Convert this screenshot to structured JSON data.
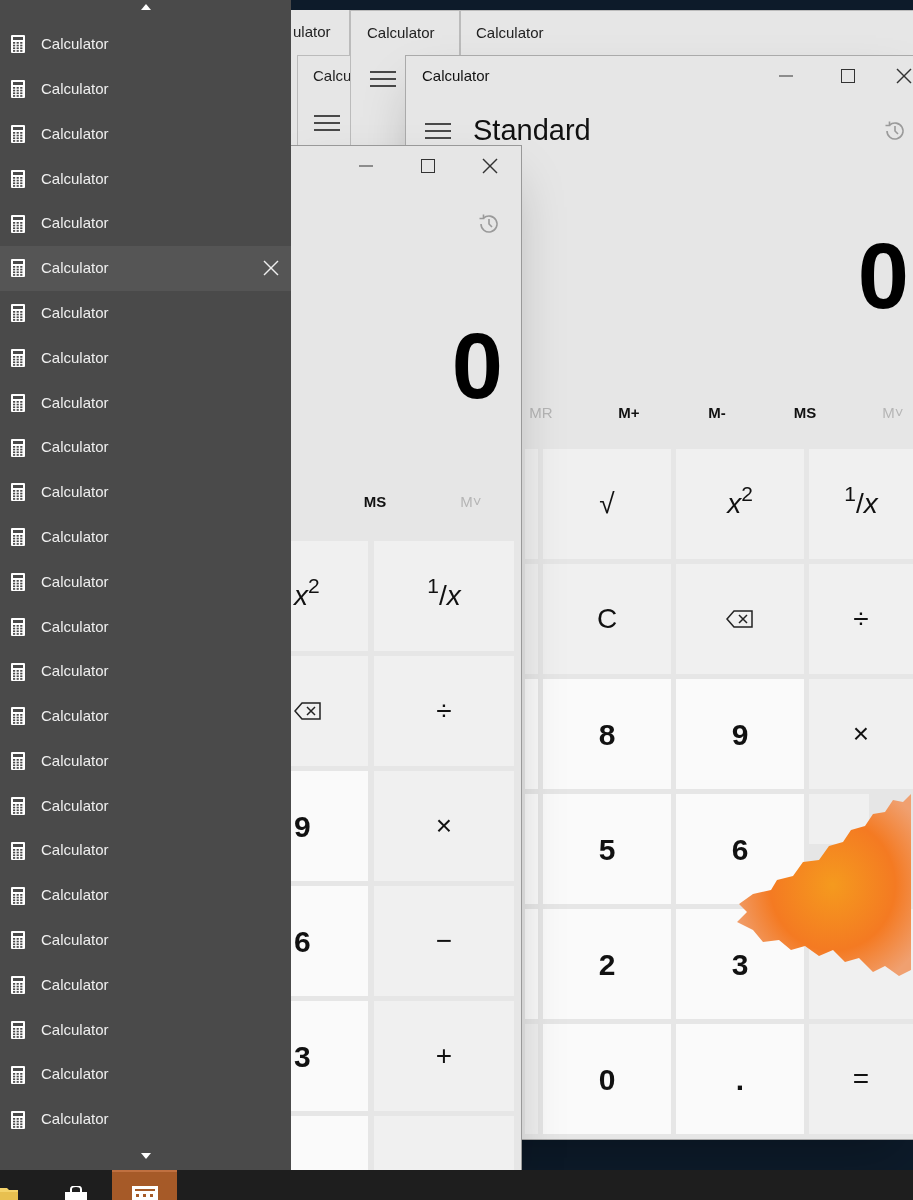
{
  "background_windows": [
    {
      "title": "ulator"
    },
    {
      "title": "Calculator"
    },
    {
      "title": "Calculator"
    },
    {
      "title": "Calcu"
    }
  ],
  "main_window": {
    "title": "Calculator",
    "mode": "Standard",
    "display": "0",
    "memory": [
      {
        "label": "MR",
        "disabled": true
      },
      {
        "label": "M+",
        "disabled": false
      },
      {
        "label": "M-",
        "disabled": false
      },
      {
        "label": "MS",
        "disabled": false
      },
      {
        "label": "M˅",
        "disabled": true
      }
    ],
    "keys": [
      {
        "kind": "op"
      },
      {
        "kind": "op",
        "label": "√"
      },
      {
        "kind": "op",
        "label": "*x*$^{2}$"
      },
      {
        "kind": "op",
        "label": "$^{1}$/*x*"
      },
      {
        "kind": "op"
      },
      {
        "kind": "op",
        "label": "C"
      },
      {
        "kind": "backspace"
      },
      {
        "kind": "op",
        "label": "÷"
      },
      {
        "kind": "digit"
      },
      {
        "kind": "digit",
        "label": "8"
      },
      {
        "kind": "digit",
        "label": "9"
      },
      {
        "kind": "op",
        "label": "×"
      },
      {
        "kind": "digit"
      },
      {
        "kind": "digit",
        "label": "5"
      },
      {
        "kind": "digit",
        "label": "6"
      },
      {
        "kind": "op"
      },
      {
        "kind": "digit"
      },
      {
        "kind": "digit",
        "label": "2"
      },
      {
        "kind": "digit",
        "label": "3"
      },
      {
        "kind": "op"
      },
      {
        "kind": "op"
      },
      {
        "kind": "digit",
        "label": "0"
      },
      {
        "kind": "digit",
        "label": "."
      },
      {
        "kind": "op",
        "label": "="
      }
    ]
  },
  "front_window": {
    "display": "0",
    "memory": [
      {
        "label": "MS",
        "disabled": false
      },
      {
        "label": "M˅",
        "disabled": true
      }
    ],
    "keys": [
      {
        "kind": "op",
        "label": "*x*$^{2}$"
      },
      {
        "kind": "op",
        "label": "$^{1}$/*x*"
      },
      {
        "kind": "backspace"
      },
      {
        "kind": "op",
        "label": "÷"
      },
      {
        "kind": "digit",
        "label": "9"
      },
      {
        "kind": "op",
        "label": "×"
      },
      {
        "kind": "digit",
        "label": "6"
      },
      {
        "kind": "op",
        "label": "−"
      },
      {
        "kind": "digit",
        "label": "3"
      },
      {
        "kind": "op",
        "label": "+"
      },
      {
        "kind": "digit"
      },
      {
        "kind": "op"
      }
    ]
  },
  "jump_list": {
    "items": [
      {
        "label": "Calculator",
        "hovered": false
      },
      {
        "label": "Calculator",
        "hovered": false
      },
      {
        "label": "Calculator",
        "hovered": false
      },
      {
        "label": "Calculator",
        "hovered": false
      },
      {
        "label": "Calculator",
        "hovered": false
      },
      {
        "label": "Calculator",
        "hovered": true
      },
      {
        "label": "Calculator",
        "hovered": false
      },
      {
        "label": "Calculator",
        "hovered": false
      },
      {
        "label": "Calculator",
        "hovered": false
      },
      {
        "label": "Calculator",
        "hovered": false
      },
      {
        "label": "Calculator",
        "hovered": false
      },
      {
        "label": "Calculator",
        "hovered": false
      },
      {
        "label": "Calculator",
        "hovered": false
      },
      {
        "label": "Calculator",
        "hovered": false
      },
      {
        "label": "Calculator",
        "hovered": false
      },
      {
        "label": "Calculator",
        "hovered": false
      },
      {
        "label": "Calculator",
        "hovered": false
      },
      {
        "label": "Calculator",
        "hovered": false
      },
      {
        "label": "Calculator",
        "hovered": false
      },
      {
        "label": "Calculator",
        "hovered": false
      },
      {
        "label": "Calculator",
        "hovered": false
      },
      {
        "label": "Calculator",
        "hovered": false
      },
      {
        "label": "Calculator",
        "hovered": false
      },
      {
        "label": "Calculator",
        "hovered": false
      },
      {
        "label": "Calculator",
        "hovered": false
      }
    ]
  },
  "taskbar": {
    "items": [
      {
        "kind": "folder",
        "active": false
      },
      {
        "kind": "store",
        "active": false
      },
      {
        "kind": "calculator",
        "active": true
      }
    ]
  }
}
